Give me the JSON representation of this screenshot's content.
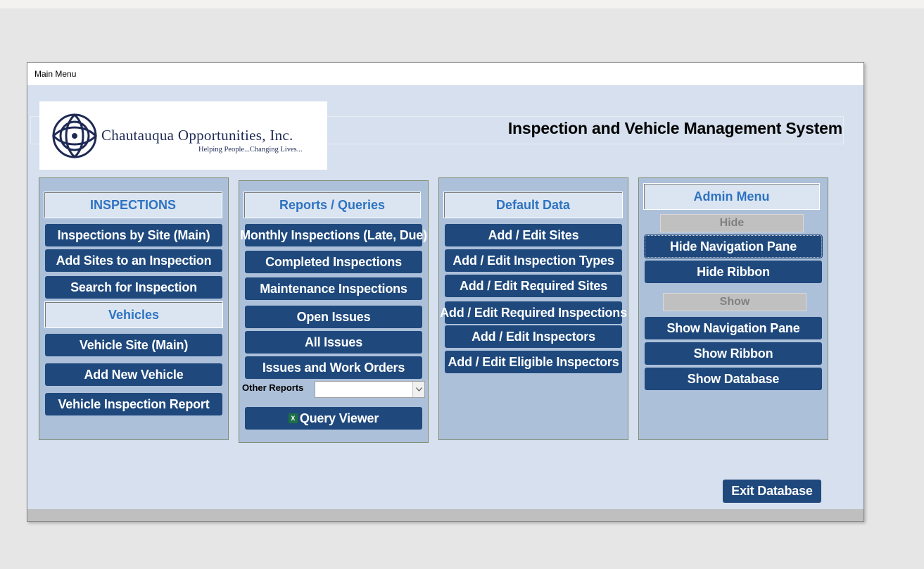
{
  "window": {
    "title": "Main Menu"
  },
  "logo": {
    "name": "Chautauqua Opportunities, Inc.",
    "tagline": "Helping People...Changing Lives..."
  },
  "app_title": "Inspection and Vehicle Management System",
  "inspections": {
    "heading": "INSPECTIONS",
    "buttons": [
      "Inspections by Site (Main)",
      "Add Sites to an Inspection",
      "Search for Inspection"
    ],
    "vehicles_heading": "Vehicles",
    "vehicle_buttons": [
      "Vehicle Site (Main)",
      "Add New Vehicle",
      "Vehicle Inspection Report"
    ]
  },
  "reports": {
    "heading": "Reports / Queries",
    "buttons": [
      "Monthly Inspections (Late, Due)",
      "Completed Inspections",
      "Maintenance Inspections",
      "Open Issues",
      "All Issues",
      "Issues and Work Orders"
    ],
    "other_reports_label": "Other Reports",
    "other_reports_value": "",
    "query_viewer": "Query Viewer"
  },
  "default_data": {
    "heading": "Default Data",
    "buttons": [
      "Add / Edit Sites",
      "Add / Edit Inspection Types",
      "Add / Edit Required Sites",
      "Add / Edit Required Inspections",
      "Add / Edit Inspectors",
      "Add / Edit Eligible Inspectors"
    ]
  },
  "admin": {
    "heading": "Admin Menu",
    "hide_label": "Hide",
    "hide_buttons": [
      "Hide Navigation Pane",
      "Hide Ribbon"
    ],
    "show_label": "Show",
    "show_buttons": [
      "Show Navigation Pane",
      "Show Ribbon",
      "Show Database"
    ]
  },
  "exit_button": "Exit Database",
  "colors": {
    "button": "#1f497d",
    "heading_text": "#2e73c2",
    "panel": "#adc0da",
    "form_bg": "#d6e0ee"
  }
}
